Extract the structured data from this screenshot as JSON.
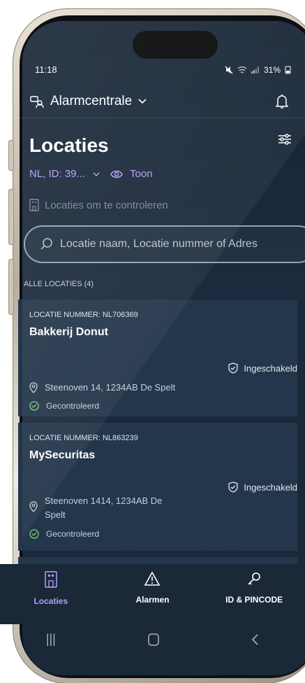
{
  "status_bar": {
    "time": "11:18",
    "battery": "31%"
  },
  "header": {
    "app_name": "Alarmcentrale"
  },
  "page": {
    "title": "Locaties",
    "account_label": "NL, ID: 39...",
    "show_label": "Toon",
    "check_locations": "Locaties om te controleren"
  },
  "search": {
    "placeholder": "Locatie naam, Locatie nummer of Adres"
  },
  "list": {
    "heading": "ALLE LOCATIES (4)",
    "items": [
      {
        "number": "LOCATIE NUMMER: NL706369",
        "name": "Bakkerij Donut",
        "state": "Ingeschakeld",
        "address": "Steenoven 14, 1234AB De Spelt",
        "check": "Gecontroleerd"
      },
      {
        "number": "LOCATIE NUMMER: NL863239",
        "name": "MySecuritas",
        "state": "Ingeschakeld",
        "address_line1": "Steenoven 1414, 1234AB De",
        "address_line2": "Spelt",
        "check": "Gecontroleerd"
      }
    ]
  },
  "tabs": [
    {
      "label": "Locaties",
      "icon": "building-icon",
      "active": true
    },
    {
      "label": "Alarmen",
      "icon": "warning-icon",
      "active": false
    },
    {
      "label": "ID & PINCODE",
      "icon": "key-icon",
      "active": false
    }
  ],
  "colors": {
    "accent": "#b89cff",
    "background": "#1b2a3c",
    "card": "#24364b"
  }
}
